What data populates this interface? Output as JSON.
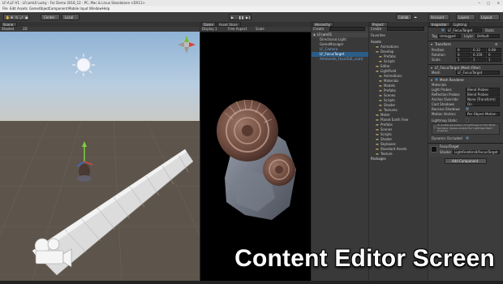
{
  "window_title": "LF-A,LF-V1 - LFcamUI Lucky - For Demo 2018_12 - PC, Mac & Linux Standalone <DX11>",
  "menu": [
    "File",
    "Edit",
    "Assets",
    "GameObject",
    "Component",
    "Mobile Input",
    "Window",
    "Help"
  ],
  "toolbar": {
    "pivot_label": "Center",
    "space_label": "Local",
    "collab_label": "Collab",
    "account_label": "Account",
    "layers_label": "Layers",
    "layout_label": "Layout"
  },
  "scene_tab": "Scene",
  "game_tab": "Game",
  "asset_store_tab": "Asset Store",
  "scene_shading": "Shaded",
  "scene_mode": "2D",
  "game_display": "Display 1",
  "game_aspect": "Free Aspect",
  "game_scale": "Scale",
  "hierarchy": {
    "tab": "Hierarchy",
    "create": "Create",
    "scene": "LFcam01",
    "items": [
      "Directional Light",
      "GameManager",
      "LF_Camera",
      "LF_FocusTarget",
      "Ammonite_Fossil(UE_scan)"
    ]
  },
  "project": {
    "tab": "Project",
    "create": "Create",
    "favorites": "Favorites",
    "assets": "Assets",
    "folders": [
      "Animations",
      "Develop",
      "Prefabs",
      "Scripts",
      "Editor",
      "LightField",
      "Animations",
      "Materials",
      "Models",
      "Prefabs",
      "Scenes",
      "Scripts",
      "Shader",
      "Textures",
      "Meter",
      "Planet Earth Free",
      "Prefabs",
      "Scenes",
      "Scripts",
      "Shader",
      "Skyboxes",
      "Standard Assets",
      "Texture"
    ],
    "packages": "Packages"
  },
  "inspector": {
    "tab": "Inspector",
    "lighting_tab": "Lighting",
    "object_name": "LF_FocusTarget",
    "static_label": "Static",
    "tag_label": "Tag",
    "tag_value": "Untagged",
    "layer_label": "Layer",
    "layer_value": "Default",
    "transform": "Transform",
    "position_label": "Position",
    "position": [
      "0",
      "0.12",
      "0.08"
    ],
    "rotation_label": "Rotation",
    "rotation": [
      "0",
      "0.159",
      "0"
    ],
    "scale_label": "Scale",
    "scale": [
      "1",
      "1",
      "1"
    ],
    "mesh_filter": "LF_FocusTarget (Mesh Filter)",
    "mesh_label": "Mesh",
    "mesh_value": "LF_FocusTarget",
    "mesh_renderer": "Mesh Renderer",
    "materials_label": "Materials",
    "light_probes_label": "Light Probes",
    "light_probes_value": "Blend Probes",
    "reflection_probes_label": "Reflection Probes",
    "reflection_probes_value": "Blend Probes",
    "anchor_override_label": "Anchor Override",
    "anchor_override_value": "None (Transform)",
    "cast_shadows_label": "Cast Shadows",
    "cast_shadows_value": "On",
    "receive_shadows_label": "Receive Shadows",
    "motion_vectors_label": "Motion Vectors",
    "motion_vectors_value": "Per Object Motion",
    "lightmap_static_label": "Lightmap Static",
    "lightmap_info": "To enable generation of lightmaps for this Mesh Renderer, please enable the 'Lightmap Static' property.",
    "dynamic_occluded_label": "Dynamic Occluded",
    "material_name": "FocusTarget",
    "shader_label": "Shader",
    "shader_value": "LightFieldUnlit/FocusTarget",
    "add_component": "Add Component"
  },
  "caption": "Content Editor Screen"
}
